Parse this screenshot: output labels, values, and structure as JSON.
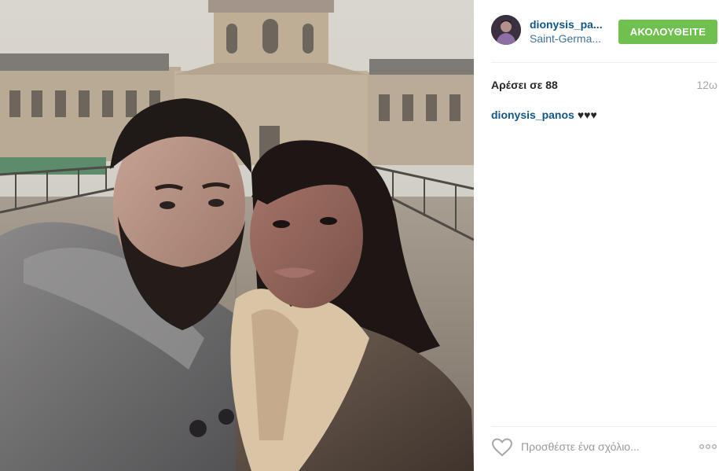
{
  "post": {
    "photo_alt": "",
    "user": {
      "username": "dionysis_pa...",
      "location": "Saint-Germa..."
    },
    "follow_label": "ΑΚΟΛΟΥΘΕΙΤΕ",
    "likes_text": "Αρέσει σε 88",
    "time_ago": "12ω",
    "caption": {
      "author": "dionysis_panos",
      "text": "♥♥♥"
    },
    "comment_placeholder": "Προσθέστε ένα σχόλιο...",
    "icons": {
      "like": "heart-outline-icon",
      "more": "more-options-icon"
    }
  },
  "colors": {
    "follow_button": "#70c050",
    "username_link": "#125688",
    "location_link": "#3f729b",
    "muted_text": "#a5a7aa"
  }
}
